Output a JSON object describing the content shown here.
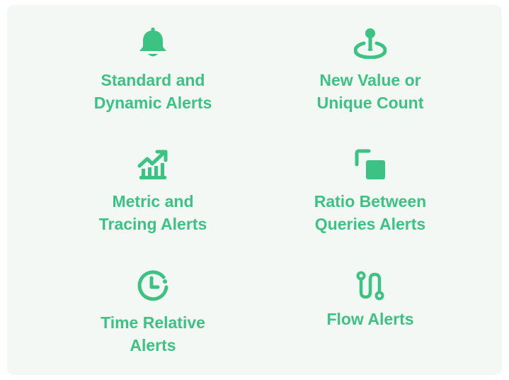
{
  "colors": {
    "accent": "#3cc283",
    "panel_background": "#f3f8f5"
  },
  "tiles": [
    {
      "icon": "bell-icon",
      "label_lines": [
        "Standard and",
        "Dynamic Alerts"
      ]
    },
    {
      "icon": "map-pin-icon",
      "label_lines": [
        "New Value or",
        "Unique Count"
      ]
    },
    {
      "icon": "trending-chart-icon",
      "label_lines": [
        "Metric and",
        "Tracing Alerts"
      ]
    },
    {
      "icon": "overlapping-squares-icon",
      "label_lines": [
        "Ratio Between",
        "Queries Alerts"
      ]
    },
    {
      "icon": "clock-icon",
      "label_lines": [
        "Time Relative",
        "Alerts"
      ]
    },
    {
      "icon": "flow-route-icon",
      "label_lines": [
        "Flow Alerts"
      ]
    }
  ]
}
